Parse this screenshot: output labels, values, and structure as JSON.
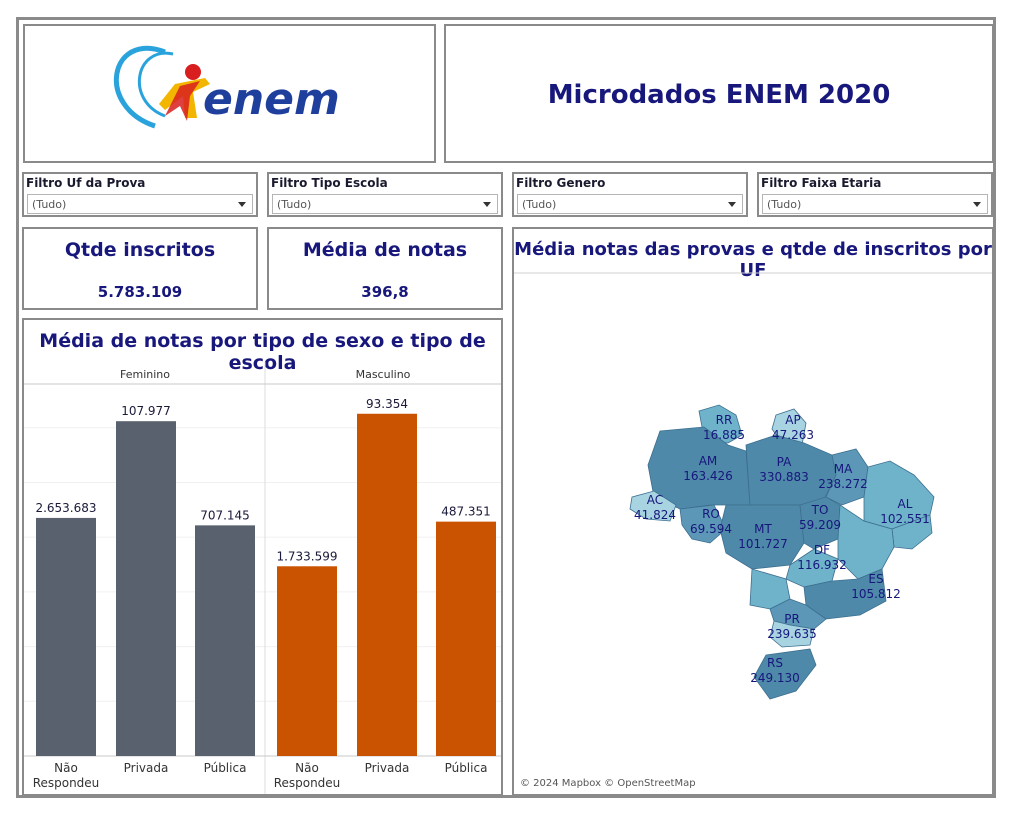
{
  "header": {
    "logo_text": "enem",
    "title": "Microdados ENEM 2020"
  },
  "filters": [
    {
      "label": "Filtro Uf da Prova",
      "value": "(Tudo)"
    },
    {
      "label": "Filtro Tipo Escola",
      "value": "(Tudo)"
    },
    {
      "label": "Filtro Genero",
      "value": "(Tudo)"
    },
    {
      "label": "Filtro Faixa Etaria",
      "value": "(Tudo)"
    }
  ],
  "kpis": [
    {
      "title": "Qtde inscritos",
      "value": "5.783.109"
    },
    {
      "title": "Média de notas",
      "value": "396,8"
    }
  ],
  "bar_panel": {
    "title": "Média de notas por tipo de sexo e tipo de escola"
  },
  "map_panel": {
    "title": "Média notas das provas e qtde de inscritos por UF",
    "credit": "© 2024 Mapbox © OpenStreetMap"
  },
  "colors": {
    "feminino": "#59616e",
    "masculino": "#c95300",
    "title": "#17177c"
  },
  "chart_data": [
    {
      "type": "bar",
      "title": "Média de notas por tipo de sexo e tipo de escola",
      "panels": [
        "Feminino",
        "Masculino"
      ],
      "categories": [
        [
          "Não",
          "Respondeu"
        ],
        [
          "Privada"
        ],
        [
          "Pública"
        ]
      ],
      "series": [
        {
          "name": "Feminino",
          "values": [
            2653683,
            107977,
            707145
          ],
          "labels": [
            "2.653.683",
            "107.977",
            "707.145"
          ],
          "heights": [
            0.64,
            0.9,
            0.62
          ]
        },
        {
          "name": "Masculino",
          "values": [
            1733599,
            93354,
            487351
          ],
          "labels": [
            "1.733.599",
            "93.354",
            "487.351"
          ],
          "heights": [
            0.51,
            0.92,
            0.63
          ]
        }
      ]
    },
    {
      "type": "map",
      "title": "Média notas das provas e qtde de inscritos por UF",
      "states": [
        {
          "uf": "RR",
          "value": "16.885"
        },
        {
          "uf": "AP",
          "value": "47.263"
        },
        {
          "uf": "AM",
          "value": "163.426"
        },
        {
          "uf": "PA",
          "value": "330.883"
        },
        {
          "uf": "MA",
          "value": "238.272"
        },
        {
          "uf": "AC",
          "value": "41.824"
        },
        {
          "uf": "RO",
          "value": "69.594"
        },
        {
          "uf": "TO",
          "value": "59.209"
        },
        {
          "uf": "AL",
          "value": "102.551"
        },
        {
          "uf": "MT",
          "value": "101.727"
        },
        {
          "uf": "DF",
          "value": "116.932"
        },
        {
          "uf": "ES",
          "value": "105.812"
        },
        {
          "uf": "PR",
          "value": "239.635"
        },
        {
          "uf": "RS",
          "value": "249.130"
        }
      ]
    }
  ]
}
